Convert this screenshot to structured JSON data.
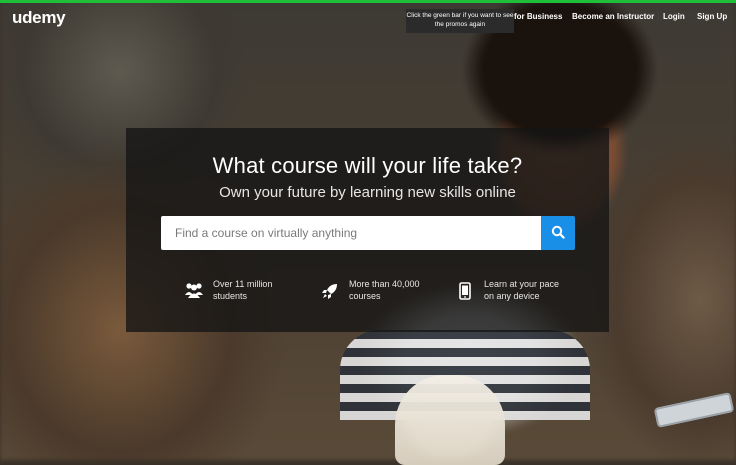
{
  "brand": {
    "logo_text": "udemy",
    "accent_color": "#1fbf3a",
    "button_color": "#1a8fe8"
  },
  "promo_tooltip": {
    "text": "Click the green bar if you want to see the promos again"
  },
  "nav": {
    "for_business": "for Business",
    "become_instructor": "Become an Instructor",
    "login": "Login",
    "signup": "Sign Up"
  },
  "hero": {
    "title": "What course will your life take?",
    "subtitle": "Own your future by learning new skills online",
    "search_placeholder": "Find a course on virtually anything",
    "search_icon": "search-icon"
  },
  "features": [
    {
      "icon": "users-icon",
      "text": "Over 11 million students"
    },
    {
      "icon": "rocket-icon",
      "text": "More than 40,000 courses"
    },
    {
      "icon": "mobile-icon",
      "text": "Learn at your pace on any device"
    }
  ]
}
